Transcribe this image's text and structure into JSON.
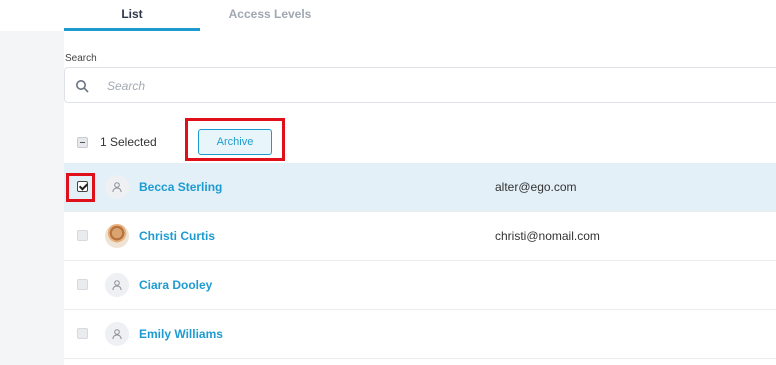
{
  "tabs": [
    {
      "label": "List",
      "active": true
    },
    {
      "label": "Access Levels",
      "active": false
    }
  ],
  "search": {
    "label": "Search",
    "placeholder": "Search",
    "value": ""
  },
  "toolbar": {
    "selected_text": "1 Selected",
    "archive_label": "Archive"
  },
  "users": [
    {
      "name": "Becca Sterling",
      "email": "alter@ego.com",
      "checked": true,
      "avatar": "person-icon"
    },
    {
      "name": "Christi Curtis",
      "email": "christi@nomail.com",
      "checked": false,
      "avatar": "photo"
    },
    {
      "name": "Ciara Dooley",
      "email": "",
      "checked": false,
      "avatar": "person-icon"
    },
    {
      "name": "Emily Williams",
      "email": "",
      "checked": false,
      "avatar": "person-icon"
    }
  ],
  "colors": {
    "accent": "#1d9bd1",
    "selected_row": "#e3f0f8",
    "highlight": "#e0101b"
  }
}
